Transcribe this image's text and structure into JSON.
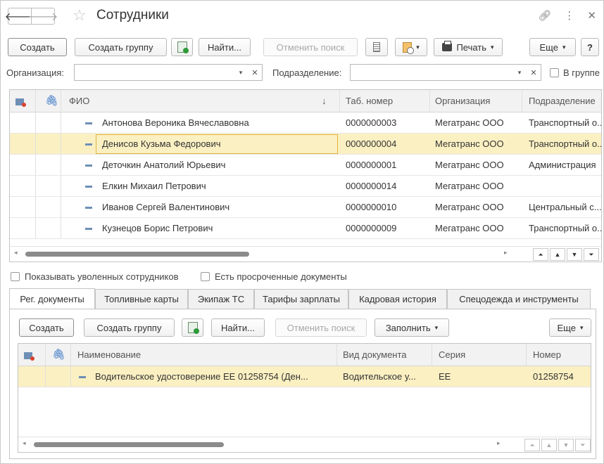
{
  "window": {
    "title": "Сотрудники"
  },
  "toolbar": {
    "create": "Создать",
    "create_group": "Создать группу",
    "find": "Найти...",
    "cancel_search": "Отменить поиск",
    "print": "Печать",
    "more": "Еще",
    "help": "?"
  },
  "filters": {
    "organization_label": "Организация:",
    "organization_value": "",
    "department_label": "Подразделение:",
    "department_value": "",
    "in_group_label": "В группе"
  },
  "employees": {
    "columns": [
      "ФИО",
      "Таб. номер",
      "Организация",
      "Подразделение"
    ],
    "sort_indicator": "↓",
    "rows": [
      {
        "name": "Антонова Вероника Вячеславовна",
        "tab": "0000000003",
        "org": "Мегатранс ООО",
        "dept": "Транспортный о..."
      },
      {
        "name": "Денисов Кузьма Федорович",
        "tab": "0000000004",
        "org": "Мегатранс ООО",
        "dept": "Транспортный о..."
      },
      {
        "name": "Деточкин Анатолий Юрьевич",
        "tab": "0000000001",
        "org": "Мегатранс ООО",
        "dept": "Администрация"
      },
      {
        "name": "Елкин Михаил Петрович",
        "tab": "0000000014",
        "org": "Мегатранс ООО",
        "dept": ""
      },
      {
        "name": "Иванов Сергей Валентинович",
        "tab": "0000000010",
        "org": "Мегатранс ООО",
        "dept": "Центральный с..."
      },
      {
        "name": "Кузнецов Борис Петрович",
        "tab": "0000000009",
        "org": "Мегатранс ООО",
        "dept": "Транспортный о..."
      }
    ],
    "selected_index": 1
  },
  "options": {
    "show_fired": "Показывать уволенных сотрудников",
    "overdue_docs": "Есть просроченные документы"
  },
  "tabs": [
    "Рег. документы",
    "Топливные карты",
    "Экипаж ТС",
    "Тарифы зарплаты",
    "Кадровая история",
    "Спецодежда и инструменты"
  ],
  "sub_toolbar": {
    "create": "Создать",
    "create_group": "Создать группу",
    "find": "Найти...",
    "cancel_search": "Отменить поиск",
    "fill": "Заполнить",
    "more": "Еще"
  },
  "documents": {
    "columns": [
      "Наименование",
      "Вид документа",
      "Серия",
      "Номер"
    ],
    "rows": [
      {
        "name": "Водительское удостоверение ЕЕ 01258754 (Ден...",
        "type": "Водительское у...",
        "series": "ЕЕ",
        "number": "01258754"
      }
    ]
  },
  "colors": {
    "selection": "#fbf0c2",
    "focus_border": "#e4b43e",
    "item_marker": "#6e8fb5"
  }
}
